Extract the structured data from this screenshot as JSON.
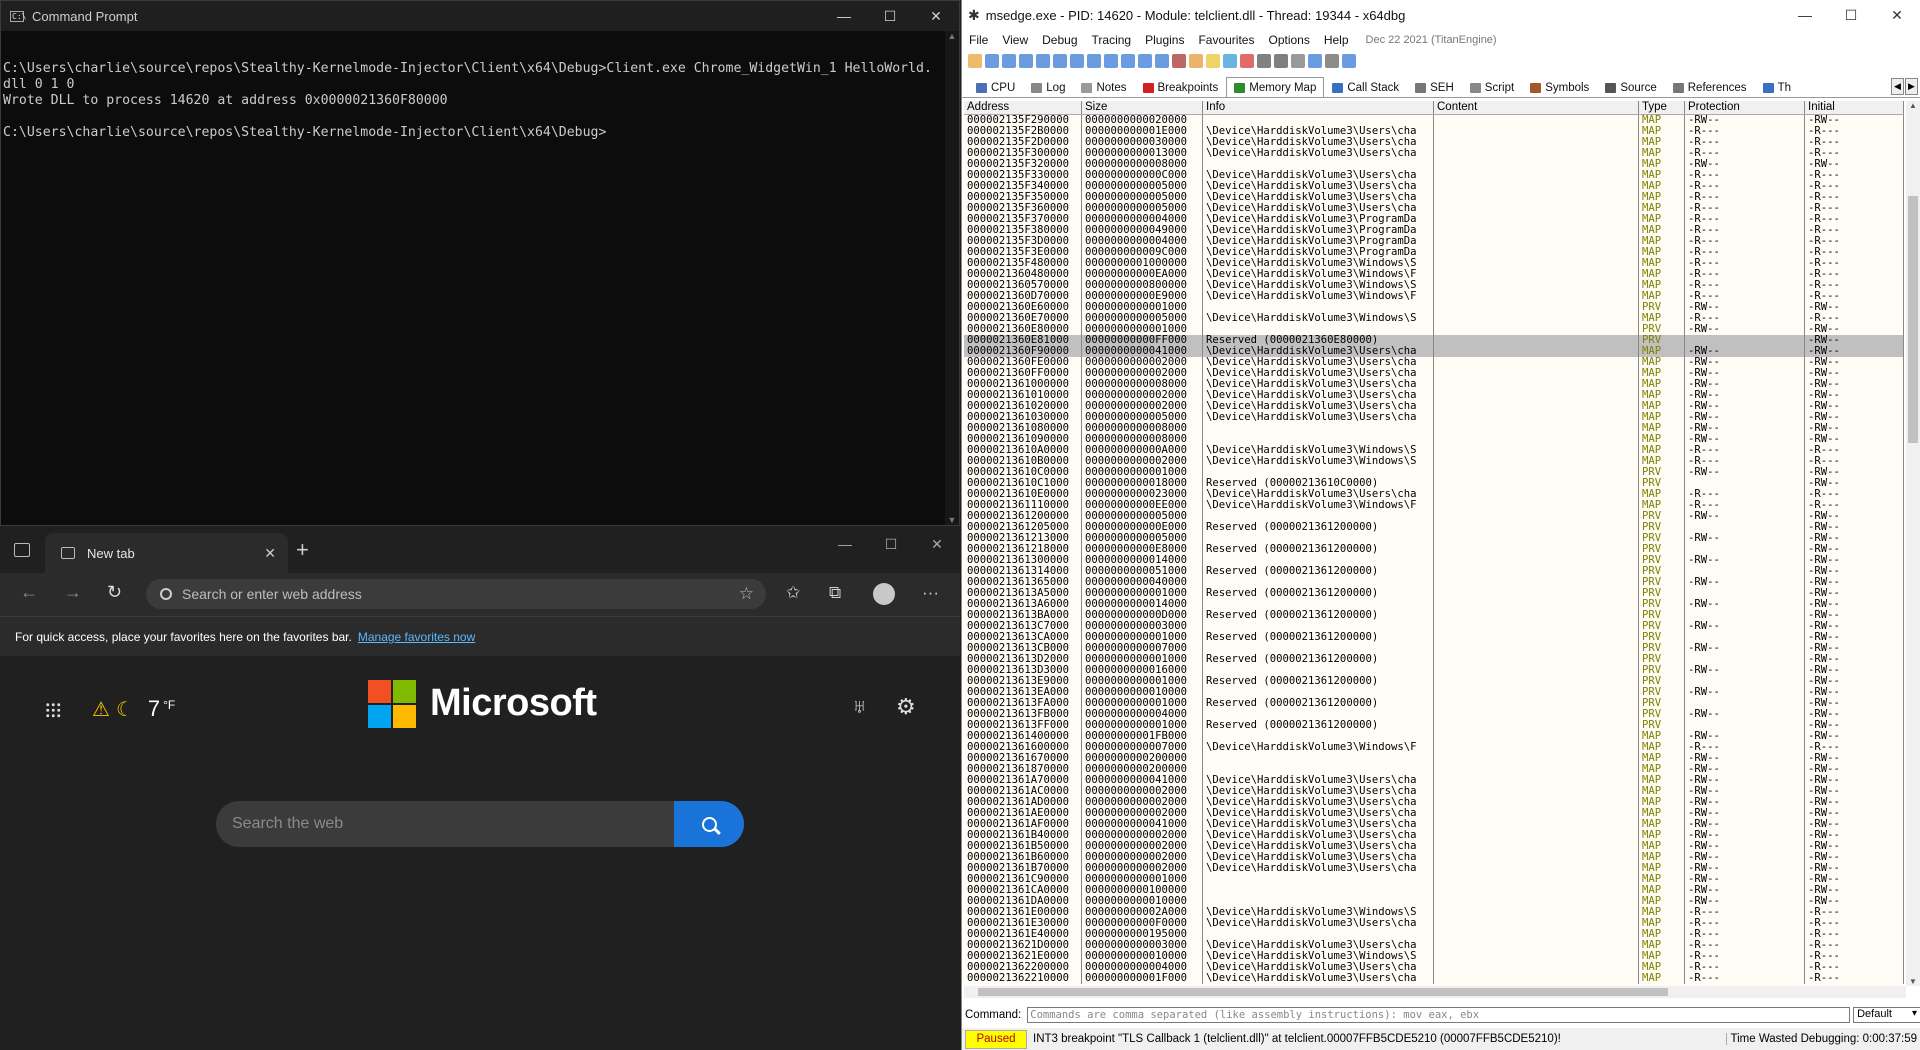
{
  "cmd": {
    "title": "Command Prompt",
    "lines": [
      "",
      "C:\\Users\\charlie\\source\\repos\\Stealthy-Kernelmode-Injector\\Client\\x64\\Debug>Client.exe Chrome_WidgetWin_1 HelloWorld.",
      "dll 0 1 0",
      "Wrote DLL to process 14620 at address 0x0000021360F80000",
      "",
      "C:\\Users\\charlie\\source\\repos\\Stealthy-Kernelmode-Injector\\Client\\x64\\Debug>"
    ]
  },
  "edge": {
    "tab_title": "New tab",
    "address_placeholder": "Search or enter web address",
    "favbar_text": "For quick access, place your favorites here on the favorites bar.",
    "favbar_link": "Manage favorites now",
    "weather_temp": "7",
    "weather_unit": "°F",
    "brand": "Microsoft",
    "search_placeholder": "Search the web"
  },
  "dbg": {
    "title": "msedge.exe - PID: 14620 - Module: telclient.dll - Thread: 19344 - x64dbg",
    "menu": [
      "File",
      "View",
      "Debug",
      "Tracing",
      "Plugins",
      "Favourites",
      "Options",
      "Help"
    ],
    "build_date": "Dec 22 2021 (TitanEngine)",
    "tabs": [
      {
        "label": "CPU",
        "color": "#4a6fb5"
      },
      {
        "label": "Log",
        "color": "#888888"
      },
      {
        "label": "Notes",
        "color": "#999999"
      },
      {
        "label": "Breakpoints",
        "color": "#d02020"
      },
      {
        "label": "Memory Map",
        "color": "#2e8b2e"
      },
      {
        "label": "Call Stack",
        "color": "#3a70c0"
      },
      {
        "label": "SEH",
        "color": "#777777"
      },
      {
        "label": "Script",
        "color": "#888888"
      },
      {
        "label": "Symbols",
        "color": "#a05a2c"
      },
      {
        "label": "Source",
        "color": "#555555"
      },
      {
        "label": "References",
        "color": "#777777"
      },
      {
        "label": "Th",
        "color": "#3a70c0"
      }
    ],
    "columns": [
      "Address",
      "Size",
      "Info",
      "Content",
      "Type",
      "Protection",
      "Initial"
    ],
    "rows": [
      [
        "000002135F290000",
        "0000000000020000",
        "",
        "",
        "MAP",
        "-RW--",
        "-RW--"
      ],
      [
        "000002135F2B0000",
        "000000000001E000",
        "\\Device\\HarddiskVolume3\\Users\\cha",
        "",
        "MAP",
        "-R---",
        "-R---"
      ],
      [
        "000002135F2D0000",
        "0000000000030000",
        "\\Device\\HarddiskVolume3\\Users\\cha",
        "",
        "MAP",
        "-R---",
        "-R---"
      ],
      [
        "000002135F300000",
        "0000000000013000",
        "\\Device\\HarddiskVolume3\\Users\\cha",
        "",
        "MAP",
        "-R---",
        "-R---"
      ],
      [
        "000002135F320000",
        "0000000000008000",
        "",
        "",
        "MAP",
        "-RW--",
        "-RW--"
      ],
      [
        "000002135F330000",
        "000000000000C000",
        "\\Device\\HarddiskVolume3\\Users\\cha",
        "",
        "MAP",
        "-R---",
        "-R---"
      ],
      [
        "000002135F340000",
        "0000000000005000",
        "\\Device\\HarddiskVolume3\\Users\\cha",
        "",
        "MAP",
        "-R---",
        "-R---"
      ],
      [
        "000002135F350000",
        "0000000000005000",
        "\\Device\\HarddiskVolume3\\Users\\cha",
        "",
        "MAP",
        "-R---",
        "-R---"
      ],
      [
        "000002135F360000",
        "0000000000005000",
        "\\Device\\HarddiskVolume3\\Users\\cha",
        "",
        "MAP",
        "-R---",
        "-R---"
      ],
      [
        "000002135F370000",
        "0000000000004000",
        "\\Device\\HarddiskVolume3\\ProgramDa",
        "",
        "MAP",
        "-R---",
        "-R---"
      ],
      [
        "000002135F380000",
        "0000000000049000",
        "\\Device\\HarddiskVolume3\\ProgramDa",
        "",
        "MAP",
        "-R---",
        "-R---"
      ],
      [
        "000002135F3D0000",
        "0000000000004000",
        "\\Device\\HarddiskVolume3\\ProgramDa",
        "",
        "MAP",
        "-R---",
        "-R---"
      ],
      [
        "000002135F3E0000",
        "000000000009C000",
        "\\Device\\HarddiskVolume3\\ProgramDa",
        "",
        "MAP",
        "-R---",
        "-R---"
      ],
      [
        "000002135F480000",
        "0000000001000000",
        "\\Device\\HarddiskVolume3\\Windows\\S",
        "",
        "MAP",
        "-R---",
        "-R---"
      ],
      [
        "0000021360480000",
        "00000000000EA000",
        "\\Device\\HarddiskVolume3\\Windows\\F",
        "",
        "MAP",
        "-R---",
        "-R---"
      ],
      [
        "0000021360570000",
        "0000000000800000",
        "\\Device\\HarddiskVolume3\\Windows\\S",
        "",
        "MAP",
        "-R---",
        "-R---"
      ],
      [
        "0000021360D70000",
        "00000000000E9000",
        "\\Device\\HarddiskVolume3\\Windows\\F",
        "",
        "MAP",
        "-R---",
        "-R---"
      ],
      [
        "0000021360E60000",
        "0000000000001000",
        "",
        "",
        "PRV",
        "-RW--",
        "-RW--"
      ],
      [
        "0000021360E70000",
        "0000000000005000",
        "\\Device\\HarddiskVolume3\\Windows\\S",
        "",
        "MAP",
        "-R---",
        "-R---"
      ],
      [
        "0000021360E80000",
        "0000000000001000",
        "",
        "",
        "PRV",
        "-RW--",
        "-RW--"
      ],
      [
        "0000021360E81000",
        "00000000000FF000",
        "Reserved (0000021360E80000)",
        "",
        "PRV",
        "",
        "-RW--"
      ],
      [
        "0000021360F90000",
        "0000000000041000",
        "\\Device\\HarddiskVolume3\\Users\\cha",
        "",
        "MAP",
        "-RW--",
        "-RW--"
      ],
      [
        "0000021360FE0000",
        "0000000000002000",
        "\\Device\\HarddiskVolume3\\Users\\cha",
        "",
        "MAP",
        "-RW--",
        "-RW--"
      ],
      [
        "0000021360FF0000",
        "0000000000002000",
        "\\Device\\HarddiskVolume3\\Users\\cha",
        "",
        "MAP",
        "-RW--",
        "-RW--"
      ],
      [
        "0000021361000000",
        "0000000000008000",
        "\\Device\\HarddiskVolume3\\Users\\cha",
        "",
        "MAP",
        "-RW--",
        "-RW--"
      ],
      [
        "0000021361010000",
        "0000000000002000",
        "\\Device\\HarddiskVolume3\\Users\\cha",
        "",
        "MAP",
        "-RW--",
        "-RW--"
      ],
      [
        "0000021361020000",
        "0000000000002000",
        "\\Device\\HarddiskVolume3\\Users\\cha",
        "",
        "MAP",
        "-RW--",
        "-RW--"
      ],
      [
        "0000021361030000",
        "0000000000005000",
        "\\Device\\HarddiskVolume3\\Users\\cha",
        "",
        "MAP",
        "-RW--",
        "-RW--"
      ],
      [
        "0000021361080000",
        "0000000000008000",
        "",
        "",
        "MAP",
        "-RW--",
        "-RW--"
      ],
      [
        "0000021361090000",
        "0000000000008000",
        "",
        "",
        "MAP",
        "-RW--",
        "-RW--"
      ],
      [
        "00000213610A0000",
        "000000000000A000",
        "\\Device\\HarddiskVolume3\\Windows\\S",
        "",
        "MAP",
        "-R---",
        "-R---"
      ],
      [
        "00000213610B0000",
        "0000000000002000",
        "\\Device\\HarddiskVolume3\\Windows\\S",
        "",
        "MAP",
        "-R---",
        "-R---"
      ],
      [
        "00000213610C0000",
        "0000000000001000",
        "",
        "",
        "PRV",
        "-RW--",
        "-RW--"
      ],
      [
        "00000213610C1000",
        "0000000000018000",
        "Reserved (00000213610C0000)",
        "",
        "PRV",
        "",
        "-RW--"
      ],
      [
        "00000213610E0000",
        "0000000000023000",
        "\\Device\\HarddiskVolume3\\Users\\cha",
        "",
        "MAP",
        "-R---",
        "-R---"
      ],
      [
        "0000021361110000",
        "00000000000EE000",
        "\\Device\\HarddiskVolume3\\Windows\\F",
        "",
        "MAP",
        "-R---",
        "-R---"
      ],
      [
        "0000021361200000",
        "0000000000005000",
        "",
        "",
        "PRV",
        "-RW--",
        "-RW--"
      ],
      [
        "0000021361205000",
        "000000000000E000",
        "Reserved (0000021361200000)",
        "",
        "PRV",
        "",
        "-RW--"
      ],
      [
        "0000021361213000",
        "0000000000005000",
        "",
        "",
        "PRV",
        "-RW--",
        "-RW--"
      ],
      [
        "0000021361218000",
        "00000000000E8000",
        "Reserved (0000021361200000)",
        "",
        "PRV",
        "",
        "-RW--"
      ],
      [
        "0000021361300000",
        "0000000000014000",
        "",
        "",
        "PRV",
        "-RW--",
        "-RW--"
      ],
      [
        "0000021361314000",
        "0000000000051000",
        "Reserved (0000021361200000)",
        "",
        "PRV",
        "",
        "-RW--"
      ],
      [
        "0000021361365000",
        "0000000000040000",
        "",
        "",
        "PRV",
        "-RW--",
        "-RW--"
      ],
      [
        "00000213613A5000",
        "0000000000001000",
        "Reserved (0000021361200000)",
        "",
        "PRV",
        "",
        "-RW--"
      ],
      [
        "00000213613A6000",
        "0000000000014000",
        "",
        "",
        "PRV",
        "-RW--",
        "-RW--"
      ],
      [
        "00000213613BA000",
        "000000000000D000",
        "Reserved (0000021361200000)",
        "",
        "PRV",
        "",
        "-RW--"
      ],
      [
        "00000213613C7000",
        "0000000000003000",
        "",
        "",
        "PRV",
        "-RW--",
        "-RW--"
      ],
      [
        "00000213613CA000",
        "0000000000001000",
        "Reserved (0000021361200000)",
        "",
        "PRV",
        "",
        "-RW--"
      ],
      [
        "00000213613CB000",
        "0000000000007000",
        "",
        "",
        "PRV",
        "-RW--",
        "-RW--"
      ],
      [
        "00000213613D2000",
        "0000000000001000",
        "Reserved (0000021361200000)",
        "",
        "PRV",
        "",
        "-RW--"
      ],
      [
        "00000213613D3000",
        "0000000000016000",
        "",
        "",
        "PRV",
        "-RW--",
        "-RW--"
      ],
      [
        "00000213613E9000",
        "0000000000001000",
        "Reserved (0000021361200000)",
        "",
        "PRV",
        "",
        "-RW--"
      ],
      [
        "00000213613EA000",
        "0000000000010000",
        "",
        "",
        "PRV",
        "-RW--",
        "-RW--"
      ],
      [
        "00000213613FA000",
        "0000000000001000",
        "Reserved (0000021361200000)",
        "",
        "PRV",
        "",
        "-RW--"
      ],
      [
        "00000213613FB000",
        "0000000000004000",
        "",
        "",
        "PRV",
        "-RW--",
        "-RW--"
      ],
      [
        "00000213613FF000",
        "0000000000001000",
        "Reserved (0000021361200000)",
        "",
        "PRV",
        "",
        "-RW--"
      ],
      [
        "0000021361400000",
        "00000000001FB000",
        "",
        "",
        "MAP",
        "-RW--",
        "-RW--"
      ],
      [
        "0000021361600000",
        "0000000000007000",
        "\\Device\\HarddiskVolume3\\Windows\\F",
        "",
        "MAP",
        "-R---",
        "-R---"
      ],
      [
        "0000021361670000",
        "0000000000200000",
        "",
        "",
        "MAP",
        "-RW--",
        "-RW--"
      ],
      [
        "0000021361870000",
        "0000000000200000",
        "",
        "",
        "MAP",
        "-RW--",
        "-RW--"
      ],
      [
        "0000021361A70000",
        "0000000000041000",
        "\\Device\\HarddiskVolume3\\Users\\cha",
        "",
        "MAP",
        "-RW--",
        "-RW--"
      ],
      [
        "0000021361AC0000",
        "0000000000002000",
        "\\Device\\HarddiskVolume3\\Users\\cha",
        "",
        "MAP",
        "-RW--",
        "-RW--"
      ],
      [
        "0000021361AD0000",
        "0000000000002000",
        "\\Device\\HarddiskVolume3\\Users\\cha",
        "",
        "MAP",
        "-RW--",
        "-RW--"
      ],
      [
        "0000021361AE0000",
        "0000000000002000",
        "\\Device\\HarddiskVolume3\\Users\\cha",
        "",
        "MAP",
        "-RW--",
        "-RW--"
      ],
      [
        "0000021361AF0000",
        "0000000000041000",
        "\\Device\\HarddiskVolume3\\Users\\cha",
        "",
        "MAP",
        "-RW--",
        "-RW--"
      ],
      [
        "0000021361B40000",
        "0000000000002000",
        "\\Device\\HarddiskVolume3\\Users\\cha",
        "",
        "MAP",
        "-RW--",
        "-RW--"
      ],
      [
        "0000021361B50000",
        "0000000000002000",
        "\\Device\\HarddiskVolume3\\Users\\cha",
        "",
        "MAP",
        "-RW--",
        "-RW--"
      ],
      [
        "0000021361B60000",
        "0000000000002000",
        "\\Device\\HarddiskVolume3\\Users\\cha",
        "",
        "MAP",
        "-RW--",
        "-RW--"
      ],
      [
        "0000021361B70000",
        "0000000000002000",
        "\\Device\\HarddiskVolume3\\Users\\cha",
        "",
        "MAP",
        "-RW--",
        "-RW--"
      ],
      [
        "0000021361C90000",
        "0000000000001000",
        "",
        "",
        "MAP",
        "-RW--",
        "-RW--"
      ],
      [
        "0000021361CA0000",
        "0000000000100000",
        "",
        "",
        "MAP",
        "-RW--",
        "-RW--"
      ],
      [
        "0000021361DA0000",
        "0000000000010000",
        "",
        "",
        "MAP",
        "-RW--",
        "-RW--"
      ],
      [
        "0000021361E00000",
        "000000000002A000",
        "\\Device\\HarddiskVolume3\\Windows\\S",
        "",
        "MAP",
        "-R---",
        "-R---"
      ],
      [
        "0000021361E30000",
        "00000000000F0000",
        "\\Device\\HarddiskVolume3\\Users\\cha",
        "",
        "MAP",
        "-R---",
        "-R---"
      ],
      [
        "0000021361E40000",
        "0000000000195000",
        "",
        "",
        "MAP",
        "-R---",
        "-R---"
      ],
      [
        "00000213621D0000",
        "0000000000003000",
        "\\Device\\HarddiskVolume3\\Users\\cha",
        "",
        "MAP",
        "-R---",
        "-R---"
      ],
      [
        "00000213621E0000",
        "0000000000010000",
        "\\Device\\HarddiskVolume3\\Windows\\S",
        "",
        "MAP",
        "-R---",
        "-R---"
      ],
      [
        "0000021362200000",
        "0000000000004000",
        "\\Device\\HarddiskVolume3\\Users\\cha",
        "",
        "MAP",
        "-R---",
        "-R---"
      ],
      [
        "0000021362210000",
        "000000000001F000",
        "\\Device\\HarddiskVolume3\\Users\\cha",
        "",
        "MAP",
        "-R---",
        "-R---"
      ]
    ],
    "selected_rows": [
      20,
      21
    ],
    "command_label": "Command:",
    "command_placeholder": "Commands are comma separated (like assembly instructions): mov eax, ebx",
    "command_mode": "Default",
    "status_state": "Paused",
    "status_message": "INT3 breakpoint \"TLS Callback 1 (telclient.dll)\" at telclient.00007FFB5CDE5210 (00007FFB5CDE5210)!",
    "time_wasted": "Time Wasted Debugging: 0:00:37:59"
  }
}
